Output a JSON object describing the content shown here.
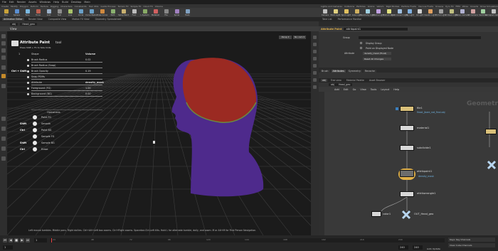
{
  "menubar": [
    "File",
    "Edit",
    "Render",
    "Assets",
    "Windows",
    "Help",
    "Build",
    "Desktop",
    "Main"
  ],
  "shelf_left": {
    "tabs": [
      "Create",
      "Modify",
      "Polygon",
      "Deform",
      "Texture",
      "Rigging",
      "Characters",
      "Constraints",
      "Hair Utils",
      "Guide Process",
      "Terrain FX",
      "Simple FX",
      "Cloud FX",
      "Volume"
    ],
    "tools": [
      "Box",
      "Sphere",
      "Tube",
      "Torus",
      "Grid",
      "Null",
      "Line",
      "Circle",
      "Curve Bezier",
      "Draw Curve",
      "Path",
      "Spray Paint",
      "Font",
      "L-System",
      "Metaball",
      "File",
      "Spiral",
      "Helix"
    ]
  },
  "shelf_right": {
    "tabs": [
      "Lights and Cameras",
      "Collisions",
      "Particles",
      "Grains",
      "Vellum",
      "Rigid Bodies",
      "Particle Fluids",
      "Viscous Fluids",
      "Oceans",
      "Pyro FX",
      "FEM",
      "Wires",
      "Crowds",
      "Drive Simulation"
    ],
    "tools": [
      "Camera",
      "Point Light",
      "Spot Light",
      "Area Light",
      "Geometry Light",
      "Volume Light",
      "Distant Light",
      "Environment Light",
      "Sky Light",
      "GI Light",
      "Caustic Light",
      "Portal Light",
      "Ambient Light",
      "Stereo Camera",
      "VR Camera",
      "Switcher",
      "Gamepad Camera"
    ]
  },
  "left_panel_tabs": [
    "Animation Editor",
    "Render View",
    "Composite View",
    "Motion FX View",
    "Geometry Spreadsheet"
  ],
  "right_panel_tabs": [
    "Tree view",
    "Material Palette",
    "Asset Browser"
  ],
  "right_top_tabs": [
    "Take List",
    "Performance Monitor"
  ],
  "viewer_path": "obj",
  "viewer_node": "Head_geo",
  "view_title": "View",
  "viewport_buttons": {
    "persp": "Persp ▾",
    "cam": "No cam ▾"
  },
  "tool_hud": {
    "title": "Attribute Paint",
    "title_suffix": "tool",
    "hint": "Press Shift + F1 to hide hints",
    "col_shape": "Shape",
    "col_volume": "Volume",
    "rows": [
      {
        "key": "",
        "label": "Brush Radius",
        "value": "0.02"
      },
      {
        "key": "",
        "label": "Brush Radius (Snap)",
        "value": ""
      },
      {
        "key": "Ctrl + Shift",
        "label": "Brush Opacity",
        "value": "0.19"
      },
      {
        "key": "",
        "label": "Snap POMs",
        "value": ""
      },
      {
        "key": "",
        "label": "Attribute",
        "value": "density_mask"
      },
      {
        "key": "",
        "label": "Foreground (FG)",
        "value": "1.00"
      },
      {
        "key": "",
        "label": "Background (BG)",
        "value": "0.00"
      }
    ],
    "ops_title": "Operations",
    "ops": [
      {
        "key": "",
        "label": "Paint FG"
      },
      {
        "key": "Shift",
        "label": "Smooth"
      },
      {
        "key": "Ctrl",
        "label": "Paint BG"
      },
      {
        "key": "",
        "label": "Sample FG"
      },
      {
        "key": "Shift",
        "label": "Sample BG"
      },
      {
        "key": "Ctrl",
        "label": "Erase"
      }
    ],
    "shape_num": "1"
  },
  "help_line": "Left mouse tumbles. Middle pans. Right dollies. Ctrl+Alt+Left box zooms. Ctrl+Right zooms. Spacebar-Ctrl-Left tilts. Hold L for alternate tumble, dolly, and zoom.    M or Alt+M for First Person Navigation.",
  "timeline": {
    "frame": "1",
    "start": "1",
    "end": "240",
    "end2": "240",
    "ticks": [
      "24",
      "48",
      "72",
      "96",
      "120",
      "144",
      "168",
      "192",
      "216",
      "240"
    ]
  },
  "params": {
    "node_type": "Attribute Paint",
    "node_name": "attribpaint1",
    "group_label": "Group",
    "display_group": "Display Group",
    "paint_displayed": "Paint on Displayed Node",
    "attribute_label": "Attribute",
    "attribute_value": "density_mask (Float)",
    "reset_label": "Reset All Changes",
    "tabs": [
      "Brush",
      "Attributes",
      "Symmetry",
      "Recache"
    ],
    "active_tab": "Attributes"
  },
  "network": {
    "path": "obj",
    "node": "Head_geo",
    "menu": [
      "Add",
      "Edit",
      "Go",
      "View",
      "Tools",
      "Layout",
      "Help"
    ],
    "watermark": "Geometry",
    "nodes": [
      {
        "name": "file1",
        "sub": "Head_(bare_not_final.obj"
      },
      {
        "name": "material1",
        "sub": ""
      },
      {
        "name": "subdivide1",
        "sub": ""
      },
      {
        "name": "attribpaint1",
        "sub": "density_mask"
      },
      {
        "name": "attribwrangle1",
        "sub": ""
      },
      {
        "name": "color1",
        "sub": ""
      },
      {
        "name": "OUT_Head_geo",
        "sub": ""
      }
    ]
  },
  "status": {
    "auto_update": "Auto Update",
    "keys": "Keys: Key Channels",
    "channels": "Clear Cube Channels"
  },
  "colors": {
    "accent": "#e0b04a",
    "node_yellow": "#d9c07a",
    "viewport_bg": "#1b1b1b",
    "mask_red": "#9b2a22",
    "mask_purple": "#4e2a8c"
  }
}
